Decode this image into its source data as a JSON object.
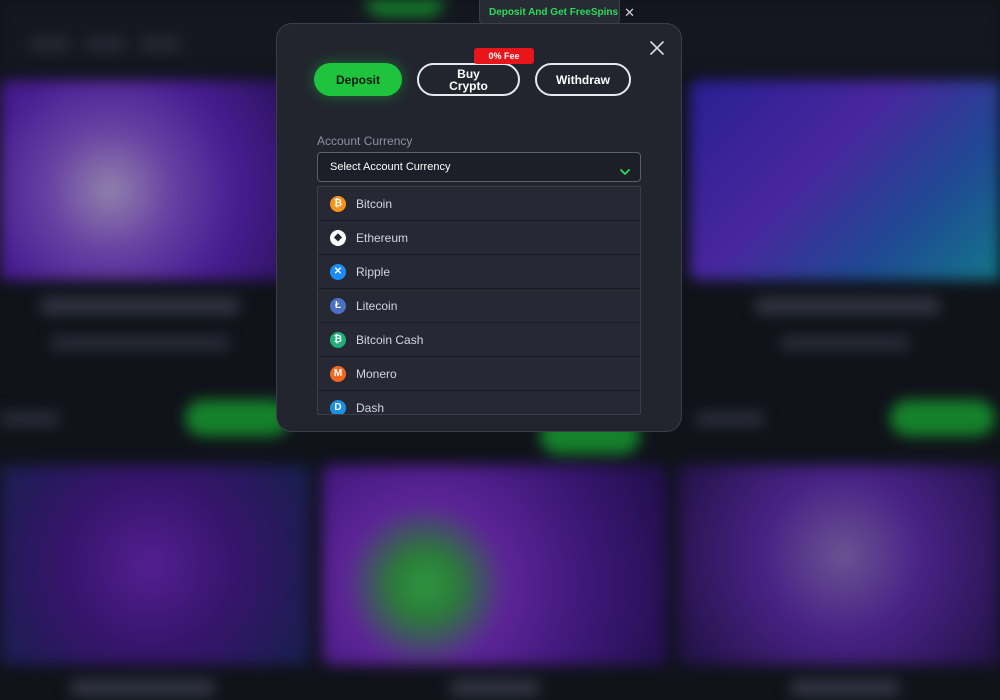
{
  "promo_tab": {
    "text": "Deposit And Get FreeSpins",
    "close": "✕"
  },
  "modal": {
    "tabs": {
      "deposit": "Deposit",
      "buy_crypto": "Buy Crypto",
      "withdraw": "Withdraw",
      "fee_badge": "0% Fee"
    },
    "account_currency_label": "Account Currency",
    "select_placeholder": "Select Account Currency",
    "currencies": [
      {
        "name": "Bitcoin",
        "icon": "bitcoin-icon",
        "symbol": "₿",
        "color": "#f7931a"
      },
      {
        "name": "Ethereum",
        "icon": "ethereum-icon",
        "symbol": "◆",
        "color": "#ffffff"
      },
      {
        "name": "Ripple",
        "icon": "ripple-icon",
        "symbol": "✕",
        "color": "#1a8cff"
      },
      {
        "name": "Litecoin",
        "icon": "litecoin-icon",
        "symbol": "Ł",
        "color": "#4c6fc4"
      },
      {
        "name": "Bitcoin Cash",
        "icon": "bitcoin-cash-icon",
        "symbol": "₿",
        "color": "#1fb07a"
      },
      {
        "name": "Monero",
        "icon": "monero-icon",
        "symbol": "M",
        "color": "#f26822"
      },
      {
        "name": "Dash",
        "icon": "dash-icon",
        "symbol": "D",
        "color": "#1c8fe3"
      }
    ]
  },
  "colors": {
    "accent_green": "#1ec43e",
    "badge_red": "#e8151b",
    "modal_bg": "#22252e"
  }
}
